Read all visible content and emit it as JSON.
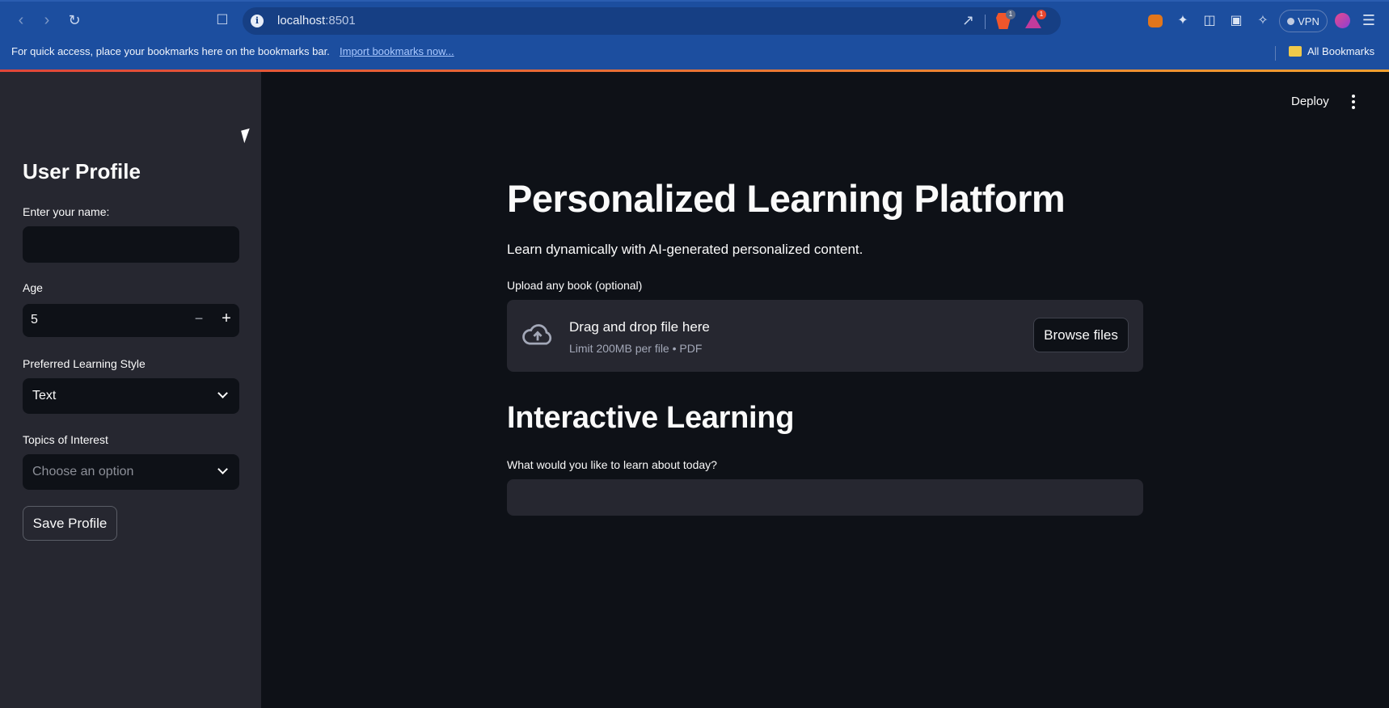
{
  "browser": {
    "url_host": "localhost",
    "url_port": ":8501",
    "vpn_label": "VPN",
    "badge_brave": "1",
    "badge_rewards": "1",
    "bookmarks_message": "For quick access, place your bookmarks here on the bookmarks bar.",
    "import_link": "Import bookmarks now...",
    "all_bookmarks": "All Bookmarks"
  },
  "sidebar": {
    "title": "User Profile",
    "name_label": "Enter your name:",
    "name_value": "",
    "age_label": "Age",
    "age_value": "5",
    "style_label": "Preferred Learning Style",
    "style_value": "Text",
    "topics_label": "Topics of Interest",
    "topics_placeholder": "Choose an option",
    "save_button": "Save Profile"
  },
  "header": {
    "deploy_label": "Deploy"
  },
  "main": {
    "title": "Personalized Learning Platform",
    "subtitle": "Learn dynamically with AI-generated personalized content.",
    "upload_label": "Upload any book (optional)",
    "drop_title": "Drag and drop file here",
    "drop_limit": "Limit 200MB per file • PDF",
    "browse_button": "Browse files",
    "section_title": "Interactive Learning",
    "question_label": "What would you like to learn about today?",
    "question_value": ""
  },
  "colors": {
    "background": "#0e1117",
    "sidebar": "#262730",
    "chrome": "#1c4e9f",
    "text": "#fafafa"
  }
}
